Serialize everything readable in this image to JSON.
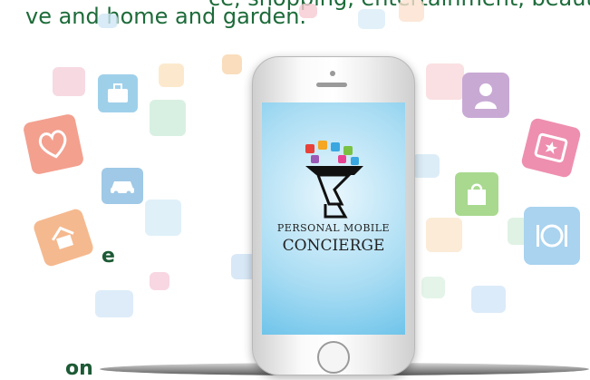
{
  "intro": {
    "line1": "ce, shopping, entertainment, beauty,",
    "line2": "ve and home and garden."
  },
  "cut_left_1": "e",
  "cut_left_2": "on",
  "phone": {
    "logo_line1": "PERSONAL MOBILE",
    "logo_line2": "CONCIERGE"
  },
  "icons": [
    "suitcase-icon",
    "heart-icon",
    "car-icon",
    "house-icon",
    "person-icon",
    "star-icon",
    "shopping-bag-icon",
    "dining-icon"
  ],
  "colors": {
    "text_green": "#1d6b3a",
    "screen_blue": "#6fc4ea"
  }
}
